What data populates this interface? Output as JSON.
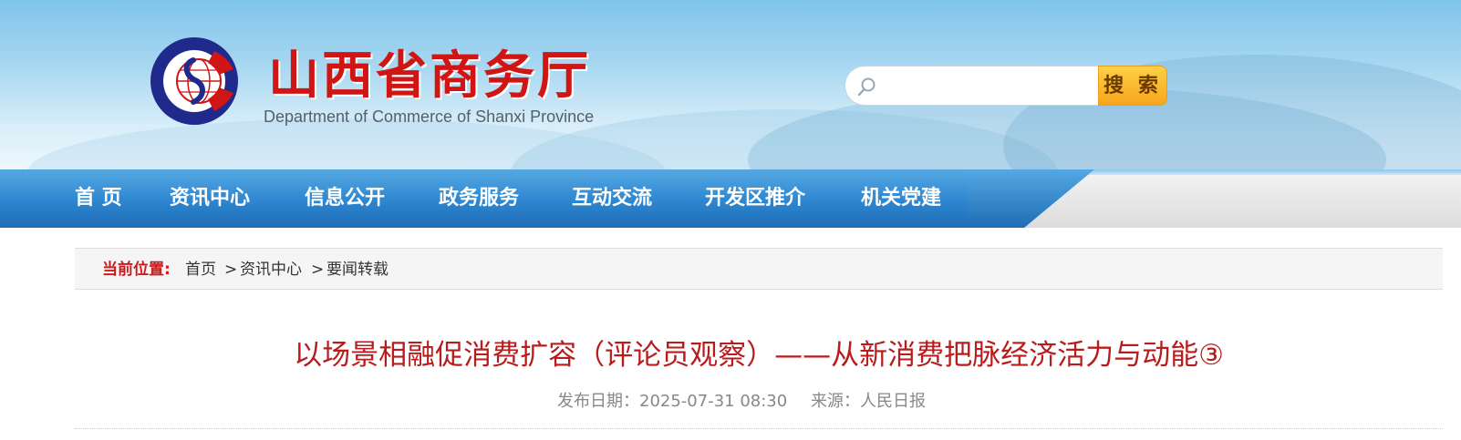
{
  "header": {
    "title": "山西省商务厅",
    "subtitle": "Department of Commerce of Shanxi Province",
    "logo_icon": "shanxi-commerce-logo"
  },
  "search": {
    "placeholder": "",
    "value": "",
    "button_label": "搜 索"
  },
  "nav": {
    "items": [
      {
        "label": "首  页"
      },
      {
        "label": "资讯中心"
      },
      {
        "label": "信息公开"
      },
      {
        "label": "政务服务"
      },
      {
        "label": "互动交流"
      },
      {
        "label": "开发区推介"
      },
      {
        "label": "机关党建"
      }
    ]
  },
  "breadcrumb": {
    "label": "当前位置:",
    "items": [
      "首页",
      "资讯中心",
      "要闻转载"
    ],
    "separator": ">"
  },
  "article": {
    "title": "以场景相融促消费扩容（评论员观察）——从新消费把脉经济活力与动能③",
    "publish_date": "发布日期：2025-07-31 08:30",
    "source": "来源：人民日报"
  },
  "colors": {
    "brand_red": "#d01515",
    "nav_blue": "#2d86cf",
    "search_orange": "#f7a51c",
    "title_red": "#b81c1c"
  }
}
